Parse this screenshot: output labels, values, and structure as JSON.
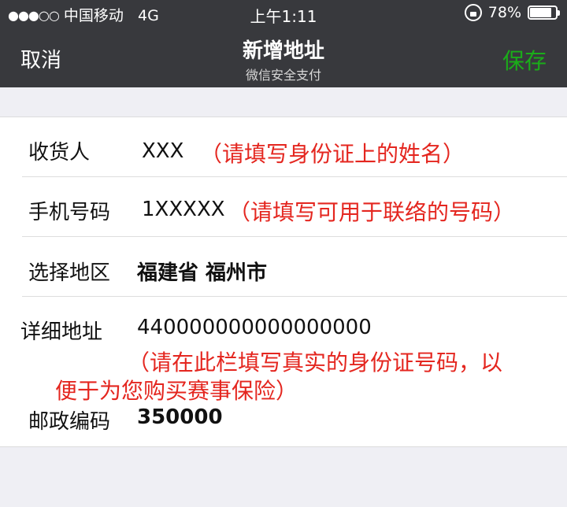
{
  "status_bar": {
    "signal": "●●●○○",
    "carrier": "中国移动",
    "network": "4G",
    "time": "上午1:11",
    "battery": "78%"
  },
  "nav": {
    "cancel": "取消",
    "title": "新增地址",
    "subtitle": "微信安全支付",
    "save": "保存"
  },
  "form": {
    "recipient": {
      "label": "收货人",
      "value": "XXX",
      "note": "（请填写身份证上的姓名）"
    },
    "phone": {
      "label": "手机号码",
      "value": "1XXXXX",
      "note": "（请填写可用于联络的号码）"
    },
    "region": {
      "label": "选择地区",
      "value": "福建省 福州市"
    },
    "address": {
      "label": "详细地址",
      "value": "440000000000000000",
      "note_line1": "（请在此栏填写真实的身份证号码，以",
      "note_line2": "便于为您购买赛事保险）"
    },
    "postcode": {
      "label": "邮政编码",
      "value": "350000"
    }
  },
  "colors": {
    "nav_bg": "#38393d",
    "save_green": "#1aad19",
    "note_red": "#e4261f",
    "page_bg": "#efeff4"
  }
}
